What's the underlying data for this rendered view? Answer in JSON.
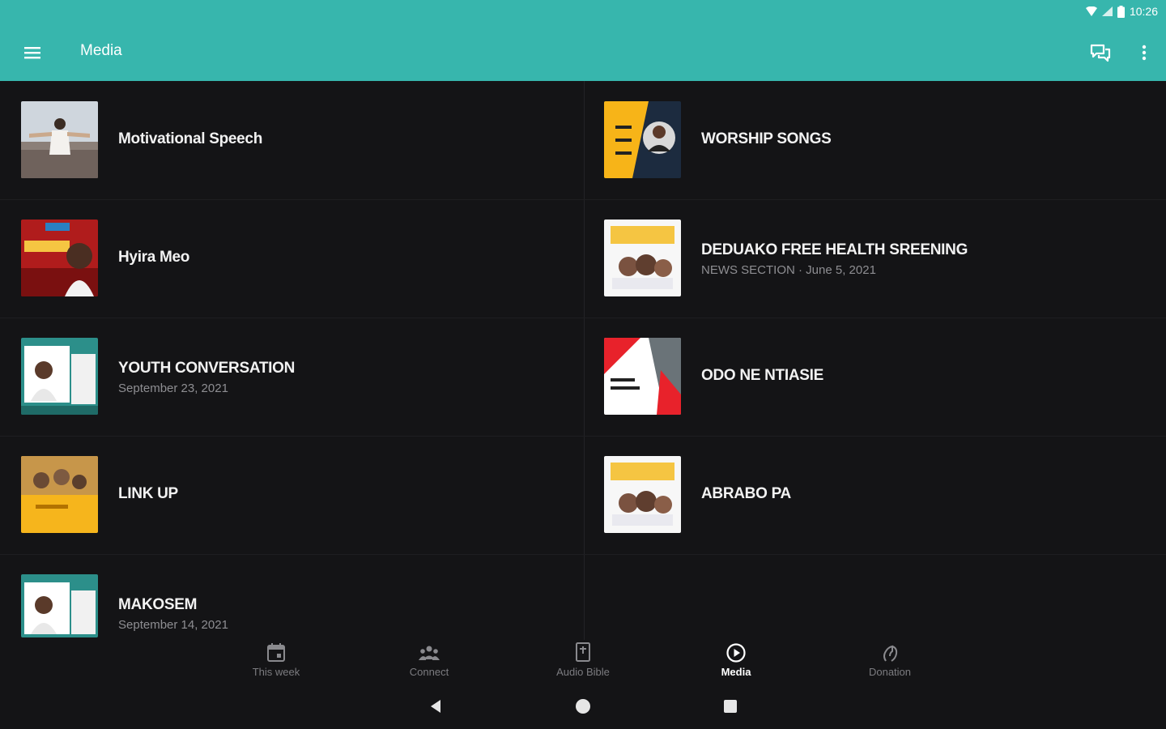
{
  "status": {
    "time": "10:26"
  },
  "appbar": {
    "title": "Media",
    "menu_icon": "hamburger-menu-icon",
    "chat_icon": "chat-bubbles-icon",
    "more_icon": "more-vert-icon"
  },
  "items": [
    {
      "title": "Motivational Speech",
      "subtitle": ""
    },
    {
      "title": "WORSHIP SONGS",
      "subtitle": ""
    },
    {
      "title": "Hyira Meo",
      "subtitle": ""
    },
    {
      "title": "DEDUAKO FREE HEALTH SREENING",
      "subtitle": "NEWS SECTION · June 5, 2021"
    },
    {
      "title": "YOUTH CONVERSATION",
      "subtitle": "September 23, 2021"
    },
    {
      "title": "ODO NE NTIASIE",
      "subtitle": ""
    },
    {
      "title": "LINK UP",
      "subtitle": ""
    },
    {
      "title": "ABRABO PA",
      "subtitle": ""
    },
    {
      "title": "MAKOSEM",
      "subtitle": "September 14, 2021"
    }
  ],
  "bottom_nav": [
    {
      "label": "This week",
      "icon": "calendar-icon",
      "active": false
    },
    {
      "label": "Connect",
      "icon": "group-icon",
      "active": false
    },
    {
      "label": "Audio Bible",
      "icon": "bible-icon",
      "active": false
    },
    {
      "label": "Media",
      "icon": "play-circle-icon",
      "active": true
    },
    {
      "label": "Donation",
      "icon": "donation-icon",
      "active": false
    }
  ],
  "colors": {
    "accent": "#37b6ad",
    "background": "#141416",
    "title_text": "#f2f2f2",
    "subtitle_text": "#8e8e92"
  }
}
